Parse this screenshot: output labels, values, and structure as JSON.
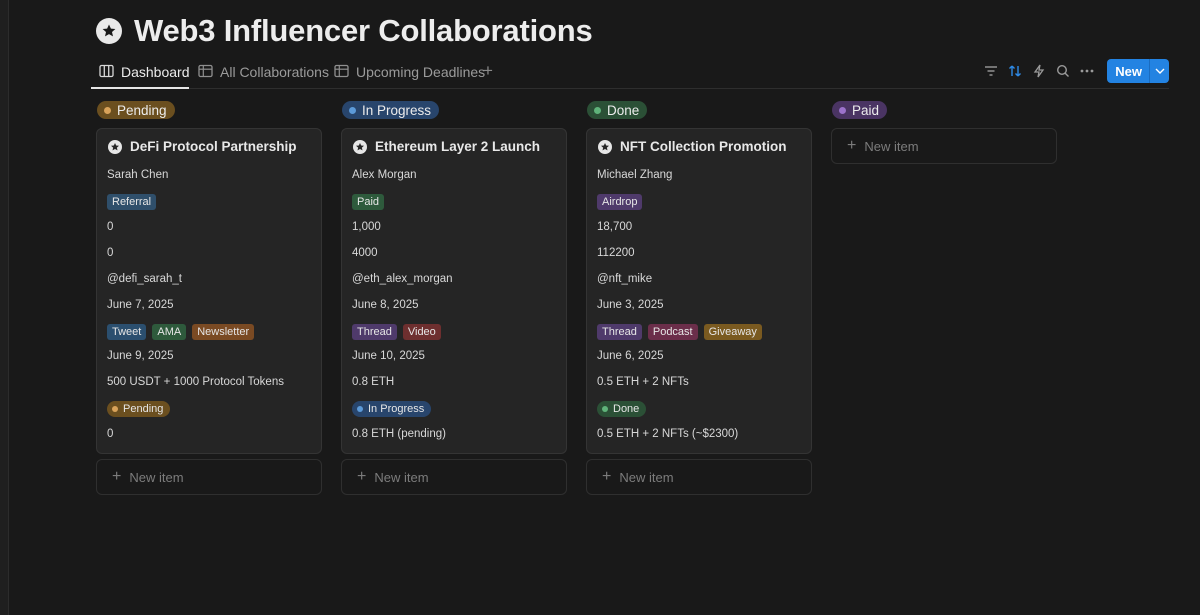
{
  "page": {
    "title": "Web3 Influencer Collaborations",
    "icon": "star-badge-icon"
  },
  "tabs": [
    {
      "label": "Dashboard",
      "icon": "board-icon",
      "active": true
    },
    {
      "label": "All Collaborations",
      "icon": "table-icon",
      "active": false
    },
    {
      "label": "Upcoming Deadlines",
      "icon": "table-icon",
      "active": false
    }
  ],
  "toolbar": {
    "icons": [
      "filter-icon",
      "sort-icon",
      "automation-icon",
      "search-icon",
      "more-icon"
    ],
    "new_label": "New"
  },
  "columns": [
    {
      "label": "Pending",
      "bg": "#6b4f1f",
      "dot": "#d9a35a"
    },
    {
      "label": "In Progress",
      "bg": "#28456c",
      "dot": "#5c9ad8"
    },
    {
      "label": "Done",
      "bg": "#2b5036",
      "dot": "#5fb37a"
    },
    {
      "label": "Paid",
      "bg": "#4a3463",
      "dot": "#9b72cb"
    }
  ],
  "new_item_label": "New item",
  "cards": [
    {
      "title": "DeFi Protocol Partnership",
      "name": "Sarah Chen",
      "type_tag": {
        "label": "Referral",
        "color": "#2f4f6b"
      },
      "num1": "0",
      "num2": "0",
      "handle": "@defi_sarah_t",
      "date1": "June 7, 2025",
      "content_tags": [
        {
          "label": "Tweet",
          "color": "#2b4f6f"
        },
        {
          "label": "AMA",
          "color": "#2e5a3c"
        },
        {
          "label": "Newsletter",
          "color": "#7a4a23"
        }
      ],
      "date2": "June 9, 2025",
      "compensation": "500 USDT + 1000 Protocol Tokens",
      "status": {
        "label": "Pending",
        "bg": "#6b4f1f",
        "dot": "#d9a35a"
      },
      "paid": "0"
    },
    {
      "title": "Ethereum Layer 2 Launch",
      "name": "Alex Morgan",
      "type_tag": {
        "label": "Paid",
        "color": "#2e5a3c"
      },
      "num1": "1,000",
      "num2": "4000",
      "handle": "@eth_alex_morgan",
      "date1": "June 8, 2025",
      "content_tags": [
        {
          "label": "Thread",
          "color": "#4f3a6b"
        },
        {
          "label": "Video",
          "color": "#6e2f2f"
        }
      ],
      "date2": "June 10, 2025",
      "compensation": "0.8 ETH",
      "status": {
        "label": "In Progress",
        "bg": "#28456c",
        "dot": "#5c9ad8"
      },
      "paid": "0.8 ETH (pending)"
    },
    {
      "title": "NFT Collection Promotion",
      "name": "Michael Zhang",
      "type_tag": {
        "label": "Airdrop",
        "color": "#4f3a6b"
      },
      "num1": "18,700",
      "num2": "112200",
      "handle": "@nft_mike",
      "date1": "June 3, 2025",
      "content_tags": [
        {
          "label": "Thread",
          "color": "#4f3a6b"
        },
        {
          "label": "Podcast",
          "color": "#6b2e4a"
        },
        {
          "label": "Giveaway",
          "color": "#7a5a20"
        }
      ],
      "date2": "June 6, 2025",
      "compensation": "0.5 ETH + 2 NFTs",
      "status": {
        "label": "Done",
        "bg": "#2b5036",
        "dot": "#5fb37a"
      },
      "paid": "0.5 ETH + 2 NFTs (~$2300)"
    }
  ]
}
